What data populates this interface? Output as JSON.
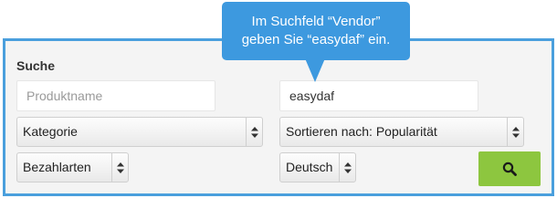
{
  "tooltip": {
    "line1": "Im Suchfeld “Vendor”",
    "line2": "geben Sie “easydaf” ein."
  },
  "search": {
    "title": "Suche",
    "product_name_placeholder": "Produktname",
    "vendor_value": "easydaf",
    "category_select": "Kategorie",
    "sort_select": "Sortieren nach: Popularität",
    "payment_select": "Bezahlarten",
    "language_select": "Deutsch",
    "submit_icon": "magnifier-icon"
  },
  "colors": {
    "frame": "#4a9fdd",
    "tooltip_bg": "#3d99df",
    "search_button": "#8dc63f"
  }
}
